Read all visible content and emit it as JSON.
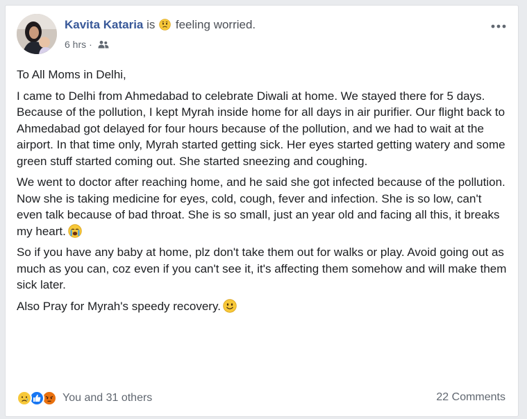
{
  "post": {
    "author": "Kavita Kataria",
    "is_word": "is",
    "feeling_text": "feeling worried.",
    "feeling_icon": "worried-face-icon",
    "timestamp": "6 hrs",
    "separator": "·",
    "audience_icon": "friends-icon",
    "more_icon": "more-options-icon",
    "paragraphs": [
      "To All Moms in Delhi,",
      "I came to Delhi from Ahmedabad to celebrate Diwali at home. We stayed there for 5 days. Because of the pollution, I kept Myrah inside home for all days in air purifier. Our flight back to Ahmedabad got delayed for four hours because of the pollution, and we had to wait at the airport. In that time only, Myrah started getting sick. Her eyes started getting watery and some green stuff started coming out. She started sneezing and coughing.",
      "We went to doctor after reaching home, and he said she got infected because of the pollution. Now she is taking medicine for eyes, cold, cough, fever and infection. She is so low, can't even talk because of bad throat. She is so small, just an year old and facing all this, it breaks my heart.",
      "So if you have any baby at home, plz don't take them out for walks or play. Avoid going out as much as you can, coz even if you can't see it, it's affecting them somehow and will make them sick later.",
      "Also Pray for Myrah's speedy recovery."
    ],
    "paragraph_emojis": {
      "p3": "crying-face-icon",
      "p5": "smiling-face-icon"
    }
  },
  "footer": {
    "reaction_icons": [
      "sad-reaction-icon",
      "like-reaction-icon",
      "angry-reaction-icon"
    ],
    "reactions_text": "You and 31 others",
    "comments_text": "22 Comments"
  },
  "colors": {
    "author_link": "#385898",
    "body_text": "#1c1e21",
    "meta_text": "#606770",
    "like_blue": "#1877f2",
    "reaction_yellow": "#f7c839",
    "angry_red": "#e9710f"
  }
}
